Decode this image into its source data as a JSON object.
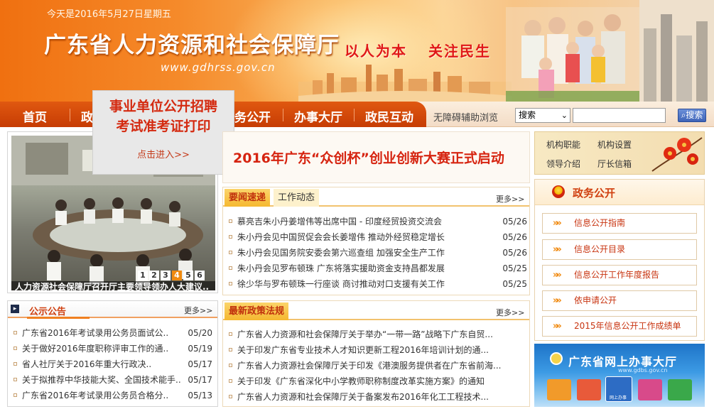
{
  "header": {
    "date_text": "今天是2016年5月27日星期五",
    "site_title": "广东省人力资源和社会保障厅",
    "site_url": "www.gdhrss.gov.cn",
    "slogan_left": "以人为本",
    "slogan_right": "关注民生"
  },
  "nav": {
    "items": [
      "首页",
      "政",
      "务公开",
      "办事大厅",
      "政民互动"
    ],
    "assist_label": "无障碍辅助浏览",
    "search_select_value": "搜索",
    "search_input_value": "",
    "search_button_label": "搜索"
  },
  "popup": {
    "title_line1": "事业单位公开招聘",
    "title_line2": "考试准考证打印",
    "link_label": "点击进入>>"
  },
  "photo": {
    "pager": [
      "1",
      "2",
      "3",
      "4",
      "5",
      "6"
    ],
    "active_index": 4,
    "caption": "人力资源社会保障厅召开厅主要领导领办人大建议.."
  },
  "headline": "2016年广东“众创杯”创业创新大赛正式启动",
  "news": {
    "tabs": [
      "要闻速递",
      "工作动态"
    ],
    "more_label": "更多>>",
    "items": [
      {
        "title": "慕亮吉朱小丹姜增伟等出席中国 - 印度经贸投资交流会",
        "date": "05/26"
      },
      {
        "title": "朱小丹会见中国贸促会会长姜增伟 推动外经贸稳定增长",
        "date": "05/26"
      },
      {
        "title": "朱小丹会见国务院安委会第六巡查组 加强安全生产工作",
        "date": "05/26"
      },
      {
        "title": "朱小丹会见罗布顿珠 广东将落实援助资金支持昌都发展",
        "date": "05/25"
      },
      {
        "title": "徐少华与罗布顿珠一行座谈 商讨推动对口支援有关工作",
        "date": "05/25"
      }
    ]
  },
  "notice": {
    "icon_symbol": "▸",
    "title": "公示公告",
    "more_label": "更多>>",
    "items": [
      {
        "title": "广东省2016年考试录用公务员面试公..",
        "date": "05/20"
      },
      {
        "title": "关于做好2016年度职称评审工作的通..",
        "date": "05/19"
      },
      {
        "title": "省人社厅关于2016年重大行政决..",
        "date": "05/17"
      },
      {
        "title": "关于拟推荐中华技能大奖、全国技术能手..",
        "date": "05/17"
      },
      {
        "title": "广东省2016年考试录用公务员合格分..",
        "date": "05/13"
      }
    ]
  },
  "policy": {
    "title": "最新政策法规",
    "more_label": "更多>>",
    "items": [
      "广东省人力资源和社会保障厅关于举办“一带一路”战略下广东自贸...",
      "关于印发广东省专业技术人才知识更新工程2016年培训计划的通...",
      "广东省人力资源社会保障厅关于印发《港澳服务提供者在广东省前海...",
      "关于印发《广东省深化中小学教师职称制度改革实施方案》的通知",
      "广东省人力资源和社会保障厅关于备案发布2016年化工工程技术..."
    ]
  },
  "org": {
    "links": [
      "机构职能",
      "机构设置",
      "领导介绍",
      "厅长信箱"
    ]
  },
  "gov": {
    "title": "政务公开",
    "links": [
      "信息公开指南",
      "信息公开目录",
      "信息公开工作年度报告",
      "依申请公开",
      "2015年信息公开工作成绩单"
    ]
  },
  "online": {
    "title": "广东省网上办事大厅",
    "url": "www.gdbs.gov.cn",
    "big_icon_label": "网上办事"
  },
  "colors": {
    "nav_orange": "#d04a0a",
    "title_red": "#d62410",
    "accent_orange": "#f08a10"
  }
}
